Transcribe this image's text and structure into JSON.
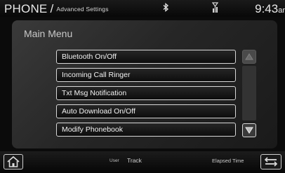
{
  "status_bar": {
    "title": "PHONE",
    "separator": "/",
    "subtitle": "Advanced Settings",
    "time": "9:43",
    "time_suffix": "ar",
    "icons": [
      "bluetooth-icon",
      "signal-icon"
    ]
  },
  "main": {
    "title": "Main Menu",
    "items": [
      {
        "label": "Bluetooth On/Off"
      },
      {
        "label": "Incoming Call Ringer"
      },
      {
        "label": "Txt Msg Notification"
      },
      {
        "label": "Auto Download On/Off"
      },
      {
        "label": "Modify Phonebook"
      }
    ]
  },
  "scroll": {
    "up_icon": "arrow-up-icon",
    "down_icon": "arrow-down-icon"
  },
  "bottom_bar": {
    "user_label": "User",
    "track_label": "Track",
    "elapsed_label": "Elapsed Time",
    "home_icon": "home-icon",
    "back_icon": "back-arrows-icon"
  },
  "colors": {
    "background": "#0b0b0b",
    "panel": "#2c2c2c",
    "button_border": "#d7d7d7",
    "text": "#e8e8e8"
  }
}
